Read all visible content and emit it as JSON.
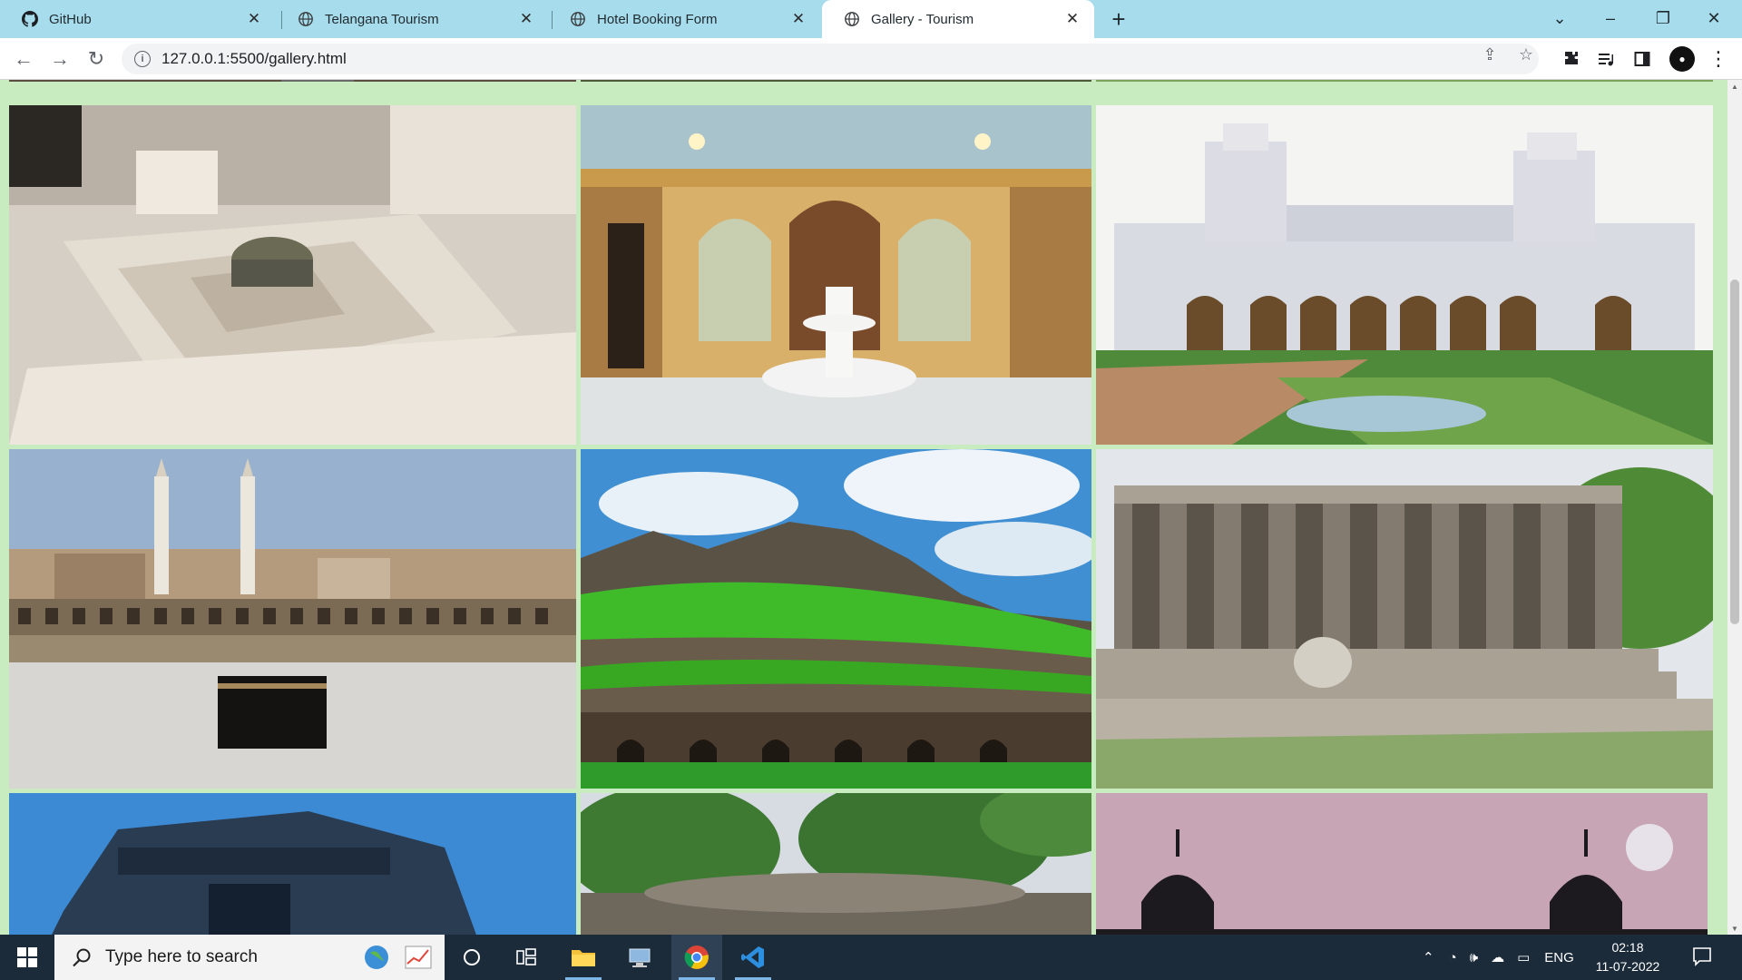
{
  "browser": {
    "tabs": [
      {
        "title": "GitHub",
        "icon": "github-icon",
        "active": false
      },
      {
        "title": "Telangana Tourism",
        "icon": "globe-icon",
        "active": false
      },
      {
        "title": "Hotel Booking Form",
        "icon": "globe-icon",
        "active": false
      },
      {
        "title": "Gallery - Tourism",
        "icon": "globe-icon",
        "active": true
      }
    ],
    "new_tab_label": "+",
    "url": "127.0.0.1:5500/gallery.html"
  },
  "gallery": {
    "images": [
      {
        "subject": "marble tomb interior"
      },
      {
        "subject": "palace hall with fountain"
      },
      {
        "subject": "chowmahalla palace"
      },
      {
        "subject": "mosque courtyard crowd"
      },
      {
        "subject": "golconda fort"
      },
      {
        "subject": "thousand pillar temple"
      },
      {
        "subject": "stone temple against blue sky"
      },
      {
        "subject": "stepwell among trees"
      },
      {
        "subject": "palace domes at dusk"
      }
    ]
  },
  "taskbar": {
    "search_placeholder": "Type here to search",
    "language": "ENG",
    "time": "02:18",
    "date": "11-07-2022"
  },
  "colors": {
    "tab_strip": "#a7dcec",
    "page_background": "#c8ecc0",
    "taskbar": "#1c2b3a"
  }
}
